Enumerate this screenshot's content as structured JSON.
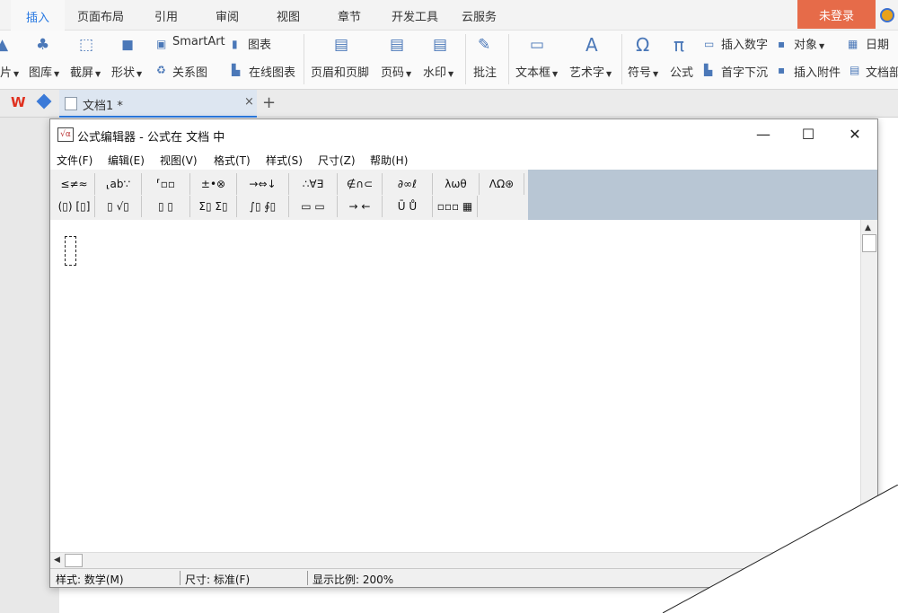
{
  "ribbon_tabs": [
    "插入",
    "页面布局",
    "引用",
    "审阅",
    "视图",
    "章节",
    "开发工具",
    "云服务"
  ],
  "login_label": "未登录",
  "ribbon": {
    "picture": "片",
    "gallery": "图库",
    "screenshot": "截屏",
    "shapes": "形状",
    "smartart": "SmartArt",
    "chart": "图表",
    "relation": "关系图",
    "online_chart": "在线图表",
    "header_footer": "页眉和页脚",
    "page_number": "页码",
    "watermark": "水印",
    "comment": "批注",
    "textbox": "文本框",
    "wordart": "艺术字",
    "symbol": "符号",
    "formula": "公式",
    "insert_number": "插入数字",
    "object": "对象",
    "date": "日期",
    "dropcap": "首字下沉",
    "attachment": "插入附件",
    "doc_part": "文档部"
  },
  "doc_tab": {
    "name": "文档1 *",
    "close": "×",
    "add": "+"
  },
  "dialog": {
    "title": "公式编辑器 - 公式在 文档 中",
    "menus": [
      "文件(F)",
      "编辑(E)",
      "视图(V)",
      "格式(T)",
      "样式(S)",
      "尺寸(Z)",
      "帮助(H)"
    ],
    "palette_row1": [
      "≤≠≈",
      "⸤ab∵",
      "⸢▫▫",
      "±•⊗",
      "→⇔↓",
      "∴∀∃",
      "∉∩⊂",
      "∂∞ℓ",
      "λωθ",
      "ΛΩ⊛"
    ],
    "palette_row2": [
      "(▯) [▯]",
      "▯ √▯",
      "▯ ▯",
      "Σ▯ Σ▯",
      "∫▯ ∮▯",
      "▭ ▭",
      "→ ←",
      "Ū Ů",
      "▫▫▫ ▦"
    ],
    "status": {
      "style": "样式: 数学(M)",
      "size": "尺寸: 标准(F)",
      "zoom": "显示比例: 200%"
    }
  },
  "colors": {
    "accent": "#2a7ae2",
    "login": "#e66b49"
  }
}
